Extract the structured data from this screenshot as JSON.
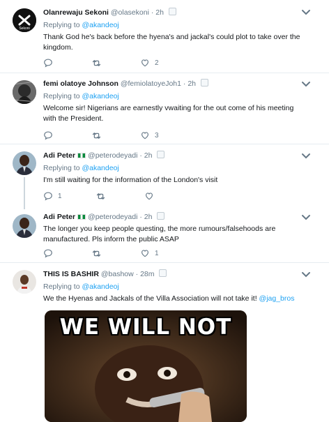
{
  "tweets": [
    {
      "name": "Olanrewaju Sekoni",
      "handle": "@olasekoni",
      "time": "2h",
      "replying_label": "Replying to",
      "replying_to": "@akandeoj",
      "text": "Thank God he's back before the hyena's and jackal's could plot to take over the kingdom.",
      "reply_count": "",
      "retweet_count": "",
      "like_count": "2"
    },
    {
      "name": "femi olatoye Johnson",
      "handle": "@femiolatoyeJoh1",
      "time": "2h",
      "replying_label": "Replying to",
      "replying_to": "@akandeoj",
      "text": "Welcome sir! Nigerians are earnestly vwaiting for the out come of his meeting with the President.",
      "reply_count": "",
      "retweet_count": "",
      "like_count": "3"
    },
    {
      "name": "Adi Peter",
      "handle": "@peterodeyadi",
      "time": "2h",
      "replying_label": "Replying to",
      "replying_to": "@akandeoj",
      "text": "I'm still waiting for the information of the London's visit",
      "reply_count": "1",
      "retweet_count": "",
      "like_count": ""
    },
    {
      "name": "Adi Peter",
      "handle": "@peterodeyadi",
      "time": "2h",
      "replying_label": "Replying to",
      "replying_to": "@akandeoj",
      "text": "The longer you keep people questing, the more rumours/falsehoods are manufactured. Pls inform the public ASAP",
      "reply_count": "",
      "retweet_count": "",
      "like_count": "1"
    },
    {
      "name": "THIS IS BASHIR",
      "handle": "@bashow",
      "time": "28m",
      "replying_label": "Replying to",
      "replying_to": "@akandeoj",
      "text": "We the Hyenas and Jackals of the Villa Association will not take it!",
      "text_mention": "@jag_bros",
      "media_caption": "WE WILL NOT"
    }
  ],
  "separator_dot": "·",
  "avatar_logo_text": "Sekoni",
  "colors": {
    "link": "#1da1f2",
    "muted": "#657786",
    "text": "#14171a",
    "border": "#e6ecf0"
  },
  "icons": [
    "reply-icon",
    "retweet-icon",
    "like-icon",
    "chevron-down-icon",
    "verified-mini-icon",
    "nigeria-flag-icon"
  ]
}
